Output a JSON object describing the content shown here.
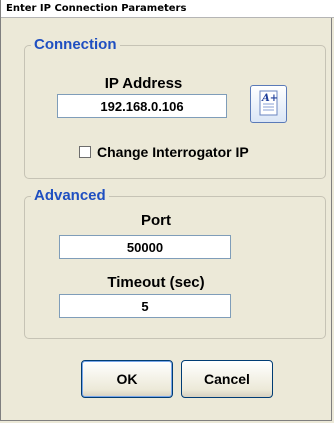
{
  "window": {
    "title": "Enter IP Connection Parameters"
  },
  "connection": {
    "legend": "Connection",
    "ip_label": "IP Address",
    "ip_value": "192.168.0.106",
    "keyboard_button_icon": "text-edit-icon",
    "checkbox_label": "Change Interrogator IP",
    "checkbox_checked": false
  },
  "advanced": {
    "legend": "Advanced",
    "port_label": "Port",
    "port_value": "50000",
    "timeout_label": "Timeout (sec)",
    "timeout_value": "5"
  },
  "buttons": {
    "ok_label": "OK",
    "cancel_label": "Cancel"
  },
  "colors": {
    "legend": "#1f4fc1",
    "background": "#ece9d8",
    "button_border": "#003c74"
  }
}
